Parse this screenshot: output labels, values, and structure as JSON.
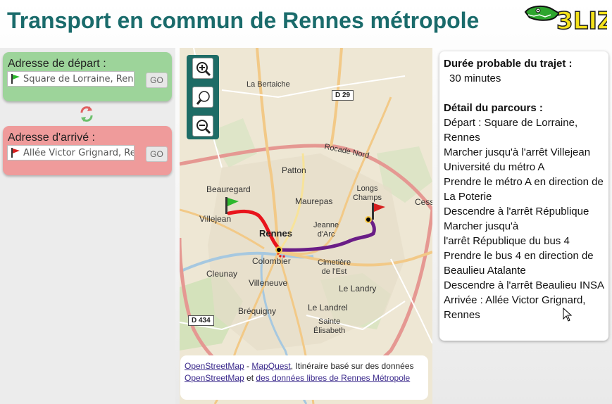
{
  "header": {
    "title": "Transport en commun de Rennes métropole",
    "logo_text": "3LIZ"
  },
  "start": {
    "label": "Adresse de départ :",
    "value": "Square de Lorraine, Rennes",
    "go_label": "GO"
  },
  "end": {
    "label": "Adresse d'arrivé :",
    "value": "Allée Victor Grignard, Rennes",
    "go_label": "GO"
  },
  "map": {
    "labels": {
      "la_bertaiche": "La Bertaiche",
      "patton": "Patton",
      "beauregard": "Beauregard",
      "longs_champs": "Longs\nChamps",
      "maurepas": "Maurepas",
      "villejean": "Villejean",
      "rennes": "Rennes",
      "jeanne_darc": "Jeanne\nd'Arc",
      "colombier": "Colombier",
      "cimetiere": "Cimetière\nde l'Est",
      "cleunay": "Cleunay",
      "villeneuve": "Villeneuve",
      "le_landry": "Le Landry",
      "brequigny": "Bréquigny",
      "le_landrel": "Le Landrel",
      "sainte_elisabeth": "Sainte\nÉlisabeth",
      "rocade_nord": "Rocade Nord",
      "cesson": "Cess"
    },
    "shields": {
      "d29": "D 29",
      "d434": "D 434"
    },
    "route_colors": {
      "walk": "#e8141c",
      "metro": "#6a1d86",
      "bus": "#7a2a8e"
    }
  },
  "attribution": {
    "osm1": "OpenStreetMap",
    "sep1": " - ",
    "mapquest": "MapQuest",
    "text1": ", Itinéraire basé sur des données ",
    "osm2": "OpenStreetMap",
    "text2": " et ",
    "rennes_data": "des données libres de Rennes Métropole"
  },
  "result": {
    "duration_heading": "Durée probable du trajet :",
    "duration_value": "30 minutes",
    "details_heading": "Détail du parcours :",
    "steps": [
      "Départ : Square de Lorraine, Rennes",
      "Marcher jusqu'à l'arrêt Villejean Université du métro A",
      "Prendre le métro A en direction de La Poterie",
      "Descendre à l'arrêt République",
      "Marcher jusqu'à",
      "l'arrêt République du bus 4",
      "Prendre le bus 4 en direction de Beaulieu Atalante",
      "Descendre à l'arrêt Beaulieu INSA",
      "Arrivée : Allée Victor Grignard, Rennes"
    ]
  },
  "colors": {
    "title": "#1a6b6b",
    "start_box": "#9dd49a",
    "end_box": "#ef9b9b",
    "zoom_bar": "#1e6c66"
  }
}
